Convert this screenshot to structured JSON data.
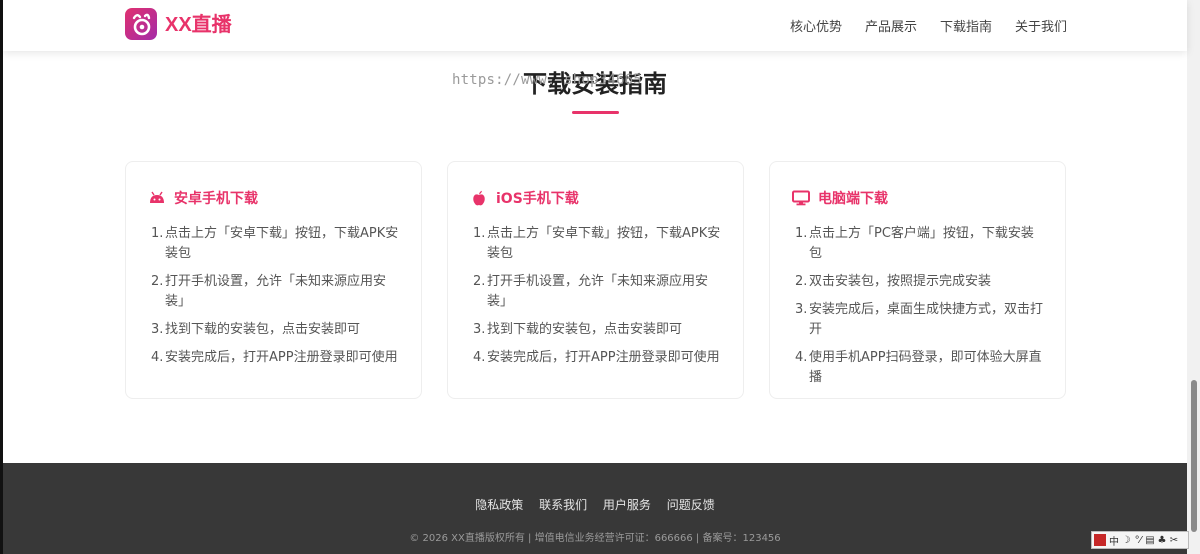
{
  "header": {
    "brand": "XX直播",
    "nav": [
      "核心优势",
      "产品展示",
      "下载指南",
      "关于我们"
    ]
  },
  "watermark": "https://www.                shop34665",
  "section": {
    "title": "下载安装指南"
  },
  "cards": [
    {
      "icon": "android-icon",
      "title": "安卓手机下载",
      "steps": [
        "点击上方「安卓下载」按钮，下载APK安装包",
        "打开手机设置，允许「未知来源应用安装」",
        "找到下载的安装包，点击安装即可",
        "安装完成后，打开APP注册登录即可使用"
      ]
    },
    {
      "icon": "apple-icon",
      "title": "iOS手机下载",
      "steps": [
        "点击上方「安卓下载」按钮，下载APK安装包",
        "打开手机设置，允许「未知来源应用安装」",
        "找到下载的安装包，点击安装即可",
        "安装完成后，打开APP注册登录即可使用"
      ]
    },
    {
      "icon": "desktop-icon",
      "title": "电脑端下载",
      "steps": [
        "点击上方「PC客户端」按钮，下载安装包",
        "双击安装包，按照提示完成安装",
        "安装完成后，桌面生成快捷方式，双击打开",
        "使用手机APP扫码登录，即可体验大屏直播"
      ]
    }
  ],
  "footer": {
    "links": [
      "隐私政策",
      "联系我们",
      "用户服务",
      "问题反馈"
    ],
    "copyright": "© 2026 XX直播版权所有 | 增值电信业务经营许可证：666666 | 备案号：123456"
  },
  "ime": {
    "lang": "中",
    "symbols": [
      "☽",
      "°⁄",
      "▤",
      "♣",
      "✂"
    ]
  },
  "colors": {
    "accent": "#e8336a",
    "footer_bg": "#383838"
  }
}
